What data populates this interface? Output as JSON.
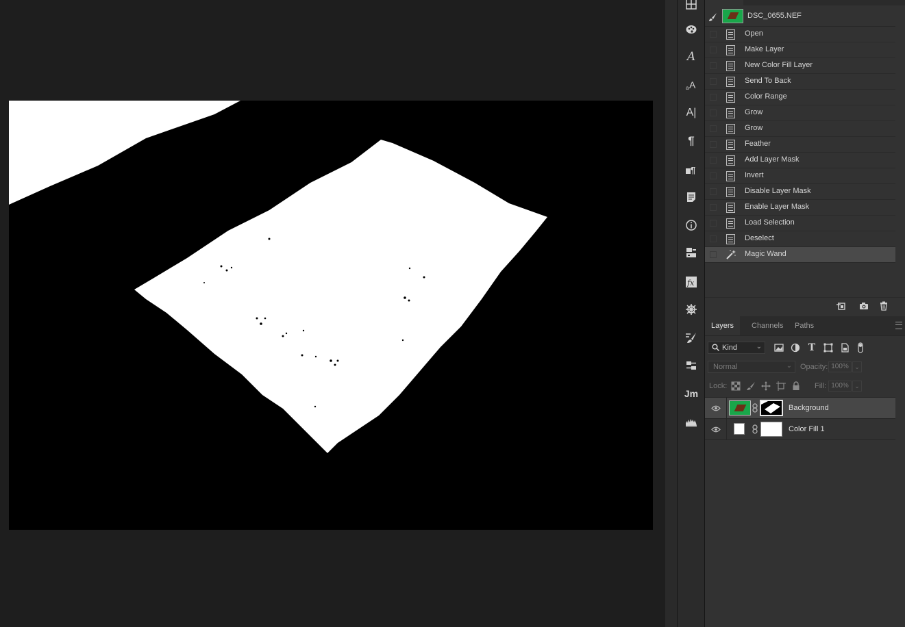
{
  "history": {
    "snapshot_name": "DSC_0655.NEF",
    "steps": [
      {
        "label": "Open",
        "icon": "document-icon"
      },
      {
        "label": "Make Layer",
        "icon": "document-icon"
      },
      {
        "label": "New Color Fill Layer",
        "icon": "document-icon"
      },
      {
        "label": "Send To Back",
        "icon": "document-icon"
      },
      {
        "label": "Color Range",
        "icon": "document-icon"
      },
      {
        "label": "Grow",
        "icon": "document-icon"
      },
      {
        "label": "Grow",
        "icon": "document-icon"
      },
      {
        "label": "Feather",
        "icon": "document-icon"
      },
      {
        "label": "Add Layer Mask",
        "icon": "document-icon"
      },
      {
        "label": "Invert",
        "icon": "document-icon"
      },
      {
        "label": "Disable Layer Mask",
        "icon": "document-icon"
      },
      {
        "label": "Enable Layer Mask",
        "icon": "document-icon"
      },
      {
        "label": "Load Selection",
        "icon": "document-icon"
      },
      {
        "label": "Deselect",
        "icon": "document-icon"
      },
      {
        "label": "Magic Wand",
        "icon": "magic-wand-icon",
        "selected": true
      }
    ]
  },
  "layers_panel": {
    "tabs": [
      "Layers",
      "Channels",
      "Paths"
    ],
    "active_tab": "Layers",
    "filter_kind": "Kind",
    "blend_mode": "Normal",
    "opacity_label": "Opacity:",
    "opacity_value": "100%",
    "lock_label": "Lock:",
    "fill_label": "Fill:",
    "fill_value": "100%",
    "layers": [
      {
        "name": "Background",
        "selected": true,
        "visible": true
      },
      {
        "name": "Color Fill 1",
        "selected": false,
        "visible": true
      }
    ]
  },
  "tool_strip": {
    "icons": [
      "grid-icon",
      "palette-icon",
      "glyph-a-icon",
      "character-styles-icon",
      "character-icon",
      "paragraph-icon",
      "paragraph-styles-icon",
      "notes-icon",
      "info-icon",
      "properties-icon",
      "styles-fx-icon",
      "navigator-icon",
      "brush-settings-icon",
      "adjustments-icon",
      "jm-plugin-icon",
      "histogram-icon"
    ],
    "char_icon_text": "A|",
    "paragraph_glyph": "¶",
    "jm_text": "Jm"
  },
  "canvas": {
    "content": "black-white-mask-view",
    "background": "#000000",
    "foreground": "#ffffff"
  },
  "colors": {
    "panel_bg": "#323232",
    "selected_row": "#4a4a4a",
    "thumb_green": "#19a64a"
  }
}
